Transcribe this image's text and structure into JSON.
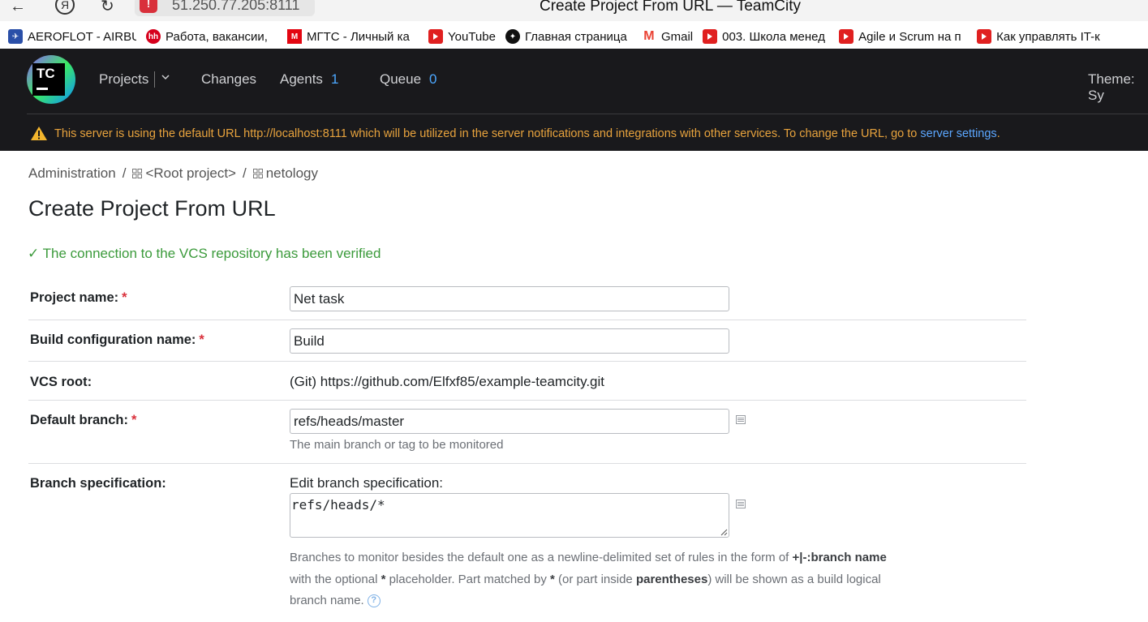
{
  "browser": {
    "url": "51.250.77.205:8111",
    "tab_title": "Create Project From URL — TeamCity",
    "back_glyph": "←",
    "yandex_glyph": "Я",
    "reload_glyph": "↻",
    "bookmarks": [
      {
        "label": "AEROFLOT - AIRBU",
        "icon": "aeroflot-icon",
        "color": "#2a4fa8"
      },
      {
        "label": "Работа, вакансии,",
        "icon": "hh-icon",
        "color": "#d6001c"
      },
      {
        "label": "МГТС - Личный ка",
        "icon": "mgts-icon",
        "color": "#e30611"
      },
      {
        "label": "YouTube",
        "icon": "youtube-icon",
        "color": "#e02020"
      },
      {
        "label": "Главная страница",
        "icon": "compass-icon",
        "color": "#111111"
      },
      {
        "label": "Gmail",
        "icon": "gmail-icon",
        "color": "#ea4335"
      },
      {
        "label": "003. Школа менед",
        "icon": "youtube-icon",
        "color": "#e02020"
      },
      {
        "label": "Agile и Scrum на п",
        "icon": "youtube-icon",
        "color": "#e02020"
      },
      {
        "label": "Как управлять IT-к",
        "icon": "youtube-icon",
        "color": "#e02020"
      }
    ]
  },
  "header": {
    "logo_text": "TC",
    "nav": {
      "projects": "Projects",
      "changes": "Changes",
      "agents": "Agents",
      "agents_count": "1",
      "queue": "Queue",
      "queue_count": "0",
      "theme": "Theme: Sy"
    },
    "warning_text": "This server is using the default URL http://localhost:8111 which will be utilized in the server notifications and integrations with other services. To change the URL, go to ",
    "warning_link": "server settings",
    "warning_end": "."
  },
  "breadcrumb": {
    "admin": "Administration",
    "sep": "/",
    "root": "<Root project>",
    "project": "netology"
  },
  "page_title": "Create Project From URL",
  "verified_message": "✓ The connection to the VCS repository has been verified",
  "form": {
    "project_name_label": "Project name:",
    "project_name_value": "Net task",
    "build_config_label": "Build configuration name:",
    "build_config_value": "Build",
    "vcs_root_label": "VCS root:",
    "vcs_root_value": "(Git) https://github.com/Elfxf85/example-teamcity.git",
    "default_branch_label": "Default branch:",
    "default_branch_value": "refs/heads/master",
    "default_branch_hint": "The main branch or tag to be monitored",
    "branch_spec_label": "Branch specification:",
    "branch_spec_edit_label": "Edit branch specification:",
    "branch_spec_value": "refs/heads/*",
    "required_mark": "*",
    "branch_spec_desc": {
      "p1": "Branches to monitor besides the default one as a newline-delimited set of rules in the form of ",
      "b1": "+|-:branch name",
      "p2": "with the optional ",
      "b2": "*",
      "p3": " placeholder. Part matched by ",
      "b3": "*",
      "p4": " (or part inside ",
      "b4": "parentheses",
      "p5": ") will be shown as a build logical",
      "p6": "branch name.",
      "help": "?"
    }
  },
  "colors": {
    "header_bg": "#19191c",
    "accent_link": "#4ca8ff",
    "warning": "#e8a33d",
    "success": "#3b9a3b",
    "required": "#d9303b"
  }
}
